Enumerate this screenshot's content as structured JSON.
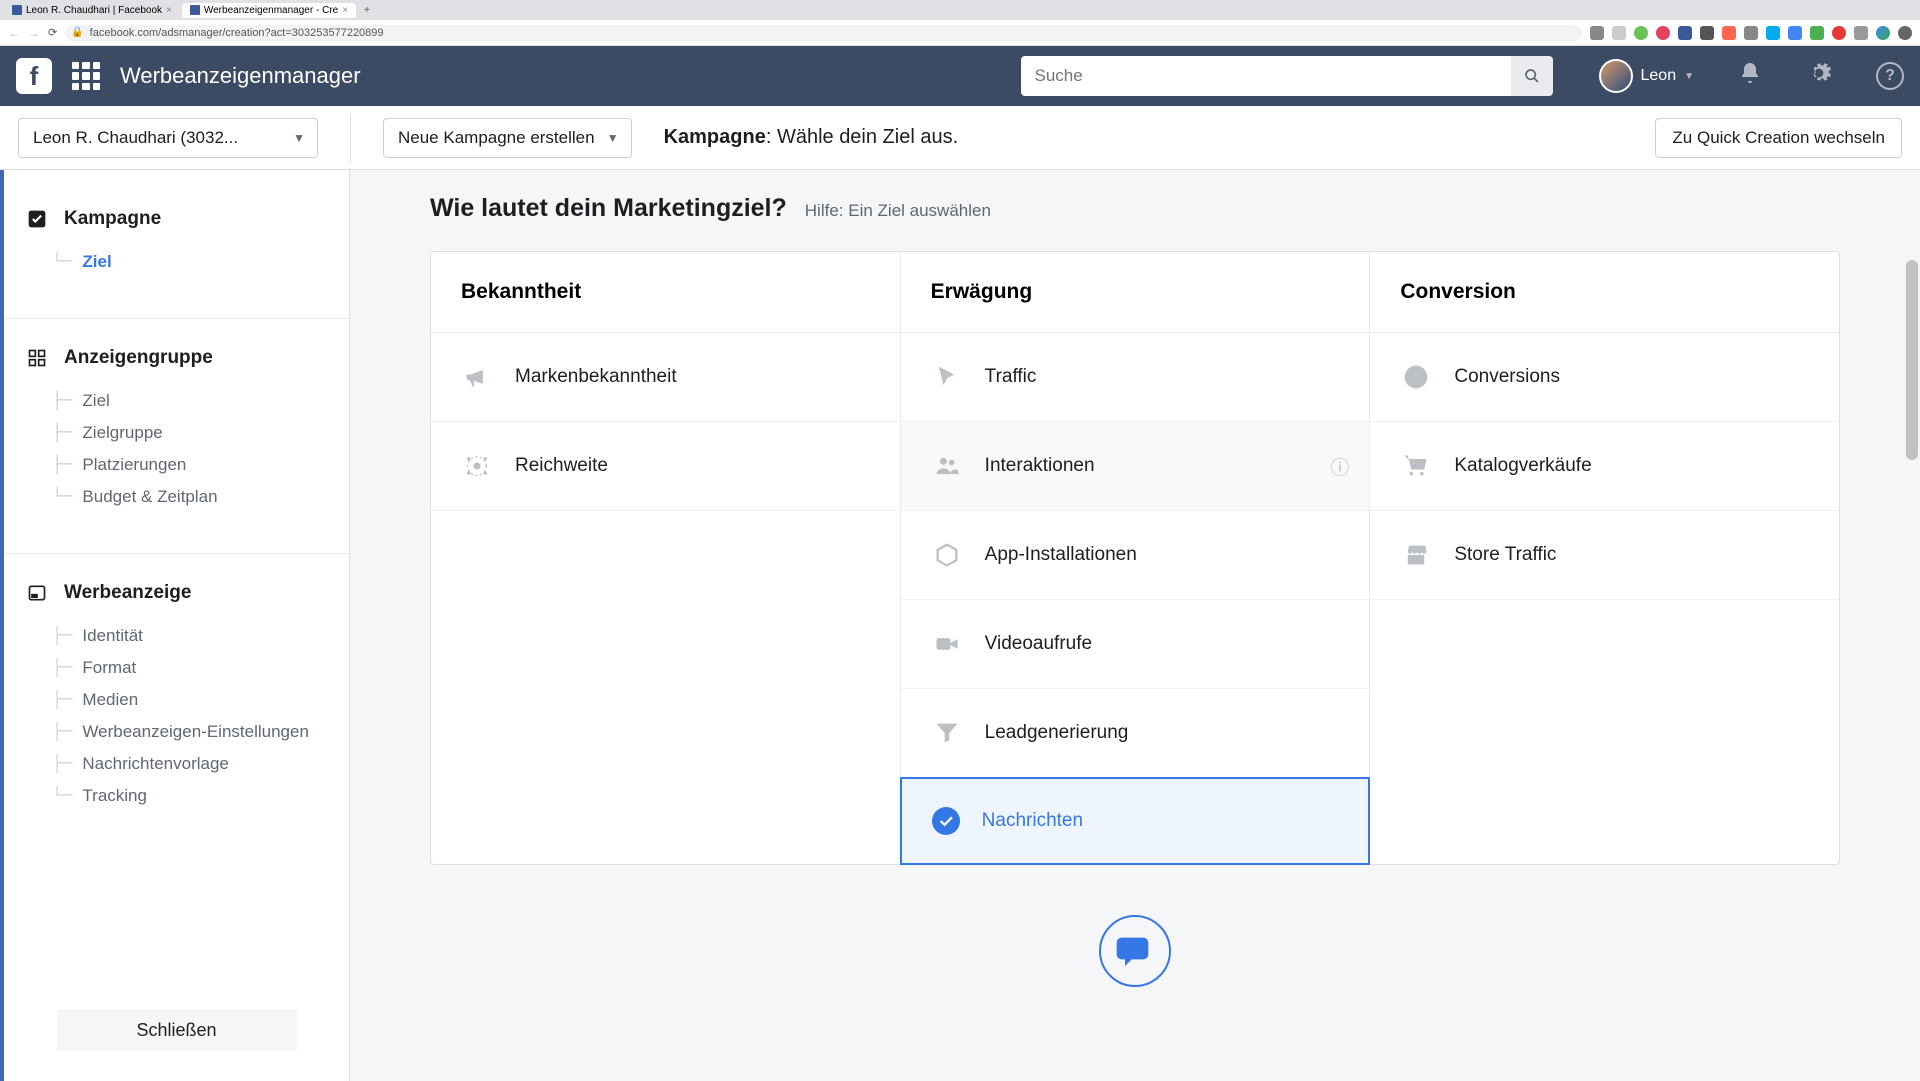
{
  "browser": {
    "tabs": [
      {
        "label": "Leon R. Chaudhari | Facebook"
      },
      {
        "label": "Werbeanzeigenmanager - Cre"
      }
    ],
    "url": "facebook.com/adsmanager/creation?act=303253577220899"
  },
  "topnav": {
    "app_title": "Werbeanzeigenmanager",
    "search_placeholder": "Suche",
    "user_name": "Leon"
  },
  "subheader": {
    "account_label": "Leon R. Chaudhari (3032...",
    "new_campaign_label": "Neue Kampagne erstellen",
    "title_bold": "Kampagne",
    "title_rest": ": Wähle dein Ziel aus.",
    "quick_label": "Zu Quick Creation wechseln"
  },
  "sidebar": {
    "sections": [
      {
        "title": "Kampagne",
        "items": [
          {
            "label": "Ziel",
            "active": true
          }
        ]
      },
      {
        "title": "Anzeigengruppe",
        "items": [
          {
            "label": "Ziel"
          },
          {
            "label": "Zielgruppe"
          },
          {
            "label": "Platzierungen"
          },
          {
            "label": "Budget & Zeitplan"
          }
        ]
      },
      {
        "title": "Werbeanzeige",
        "items": [
          {
            "label": "Identität"
          },
          {
            "label": "Format"
          },
          {
            "label": "Medien"
          },
          {
            "label": "Werbeanzeigen-Einstellungen"
          },
          {
            "label": "Nachrichtenvorlage"
          },
          {
            "label": "Tracking"
          }
        ]
      }
    ],
    "close_label": "Schließen"
  },
  "main": {
    "question": "Wie lautet dein Marketingziel?",
    "help": "Hilfe: Ein Ziel auswählen",
    "cols": {
      "awareness": {
        "title": "Bekanntheit",
        "items": [
          "Markenbekanntheit",
          "Reichweite"
        ]
      },
      "consideration": {
        "title": "Erwägung",
        "items": [
          "Traffic",
          "Interaktionen",
          "App-Installationen",
          "Videoaufrufe",
          "Leadgenerierung",
          "Nachrichten"
        ]
      },
      "conversion": {
        "title": "Conversion",
        "items": [
          "Conversions",
          "Katalogverkäufe",
          "Store Traffic"
        ]
      }
    }
  }
}
